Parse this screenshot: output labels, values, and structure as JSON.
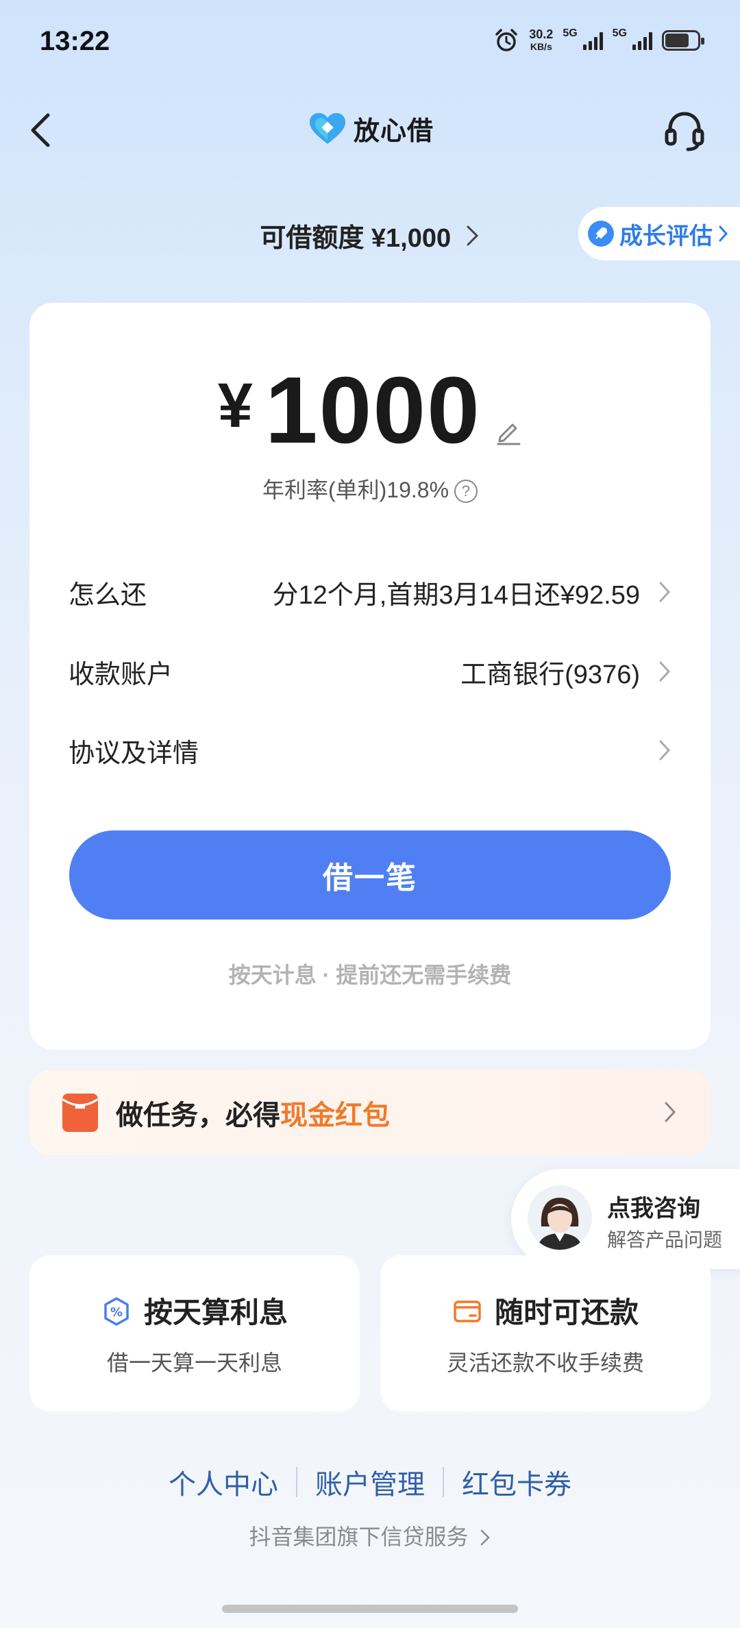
{
  "status_bar": {
    "time": "13:22",
    "net_speed_value": "30.2",
    "net_speed_unit": "KB/s",
    "signal1_label": "5G",
    "signal2_label": "5G"
  },
  "header": {
    "app_name": "放心借"
  },
  "limit": {
    "label": "可借额度 ¥1,000",
    "growth_label": "成长评估"
  },
  "loan": {
    "currency": "¥",
    "amount": "1000",
    "rate_text": "年利率(单利)19.8%",
    "rows": [
      {
        "label": "怎么还",
        "value": "分12个月,首期3月14日还¥92.59"
      },
      {
        "label": "收款账户",
        "value": "工商银行(9376)"
      },
      {
        "label": "协议及详情",
        "value": ""
      }
    ],
    "borrow_button": "借一笔",
    "note": "按天计息 · 提前还无需手续费"
  },
  "task_banner": {
    "text_prefix": "做任务，必得",
    "text_highlight": "现金红包"
  },
  "consult": {
    "title": "点我咨询",
    "subtitle": "解答产品问题"
  },
  "features": [
    {
      "title": "按天算利息",
      "subtitle": "借一天算一天利息",
      "icon": "percent-badge-icon"
    },
    {
      "title": "随时可还款",
      "subtitle": "灵活还款不收手续费",
      "icon": "card-icon"
    }
  ],
  "footer": {
    "links": [
      "个人中心",
      "账户管理",
      "红包卡券"
    ],
    "service_text": "抖音集团旗下信贷服务"
  },
  "colors": {
    "primary": "#4f7ff3",
    "highlight": "#f07a2a",
    "link": "#2f5fa8"
  }
}
